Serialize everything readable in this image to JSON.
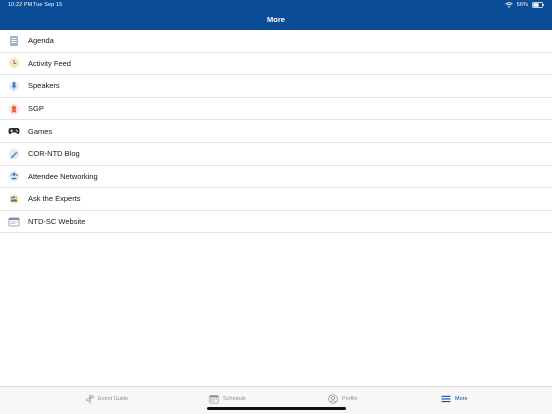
{
  "status_bar": {
    "time": "10:22 PM",
    "date": "Tue Sep 15",
    "battery": "56%"
  },
  "header": {
    "title": "More",
    "background_color": "#0b4c97"
  },
  "menu": {
    "items": [
      {
        "label": "Agenda",
        "icon": "agenda-icon"
      },
      {
        "label": "Activity Feed",
        "icon": "activity-feed-icon"
      },
      {
        "label": "Speakers",
        "icon": "speakers-icon"
      },
      {
        "label": "SGP",
        "icon": "sgp-icon"
      },
      {
        "label": "Games",
        "icon": "games-icon"
      },
      {
        "label": "COR-NTD Blog",
        "icon": "blog-icon"
      },
      {
        "label": "Attendee Networking",
        "icon": "networking-icon"
      },
      {
        "label": "Ask the Experts",
        "icon": "experts-icon"
      },
      {
        "label": "NTD-SC Website",
        "icon": "website-icon"
      }
    ]
  },
  "tabbar": {
    "tabs": [
      {
        "label": "Event Guide",
        "icon": "event-guide-icon",
        "active": false
      },
      {
        "label": "Schedule",
        "icon": "schedule-icon",
        "active": false
      },
      {
        "label": "Profile",
        "icon": "profile-icon",
        "active": false
      },
      {
        "label": "More",
        "icon": "more-icon",
        "active": true
      }
    ],
    "active_color": "#0b4c97"
  }
}
